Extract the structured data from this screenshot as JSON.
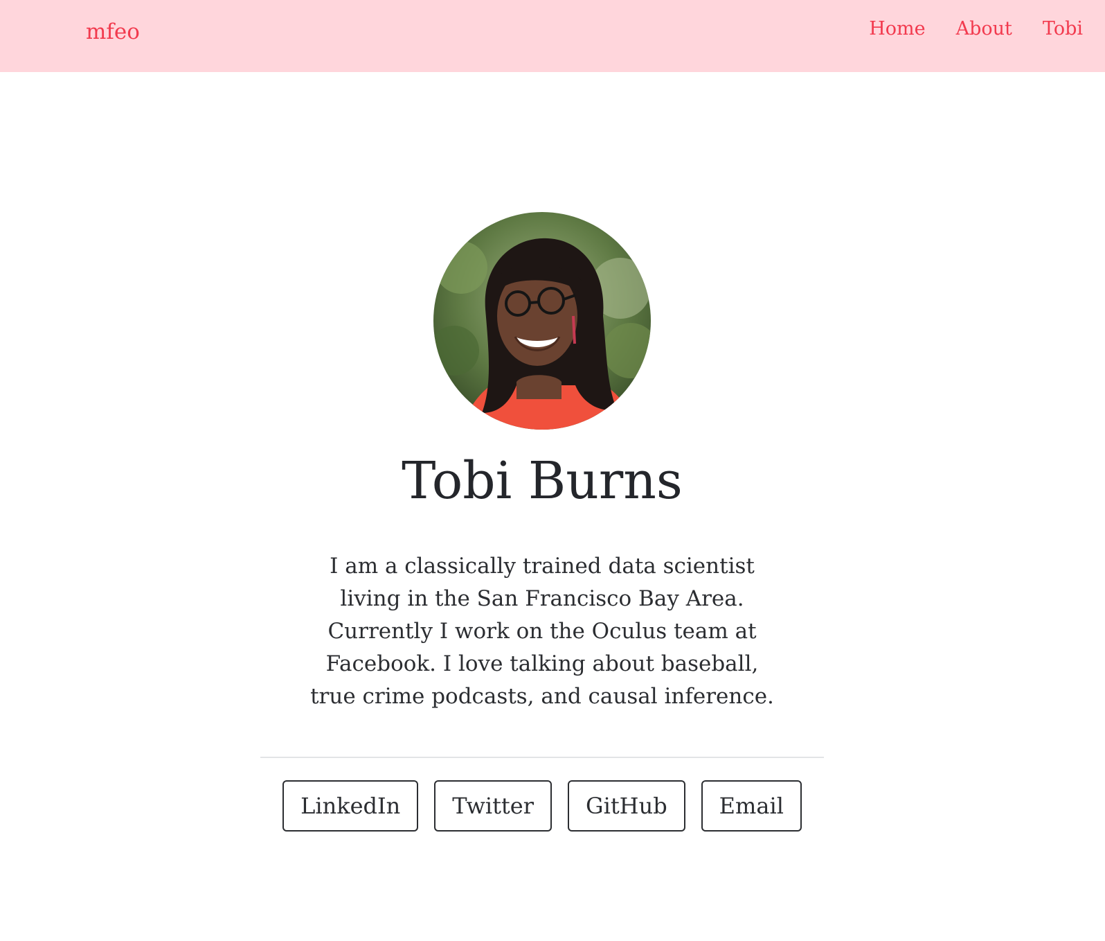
{
  "header": {
    "brand": "mfeo",
    "nav": [
      "Home",
      "About",
      "Tobi"
    ]
  },
  "profile": {
    "name": "Tobi Burns",
    "bio": "I am a classically trained data scientist living in the San Francisco Bay Area. Currently I work on the Oculus team at Facebook. I love talking about baseball, true crime podcasts, and causal inference.",
    "avatar_icon": "profile-photo"
  },
  "links": [
    "LinkedIn",
    "Twitter",
    "GitHub",
    "Email"
  ],
  "colors": {
    "header_bg": "#ffd6dc",
    "accent": "#f23a4e",
    "text": "#24262b",
    "divider": "#e2e4e6"
  }
}
